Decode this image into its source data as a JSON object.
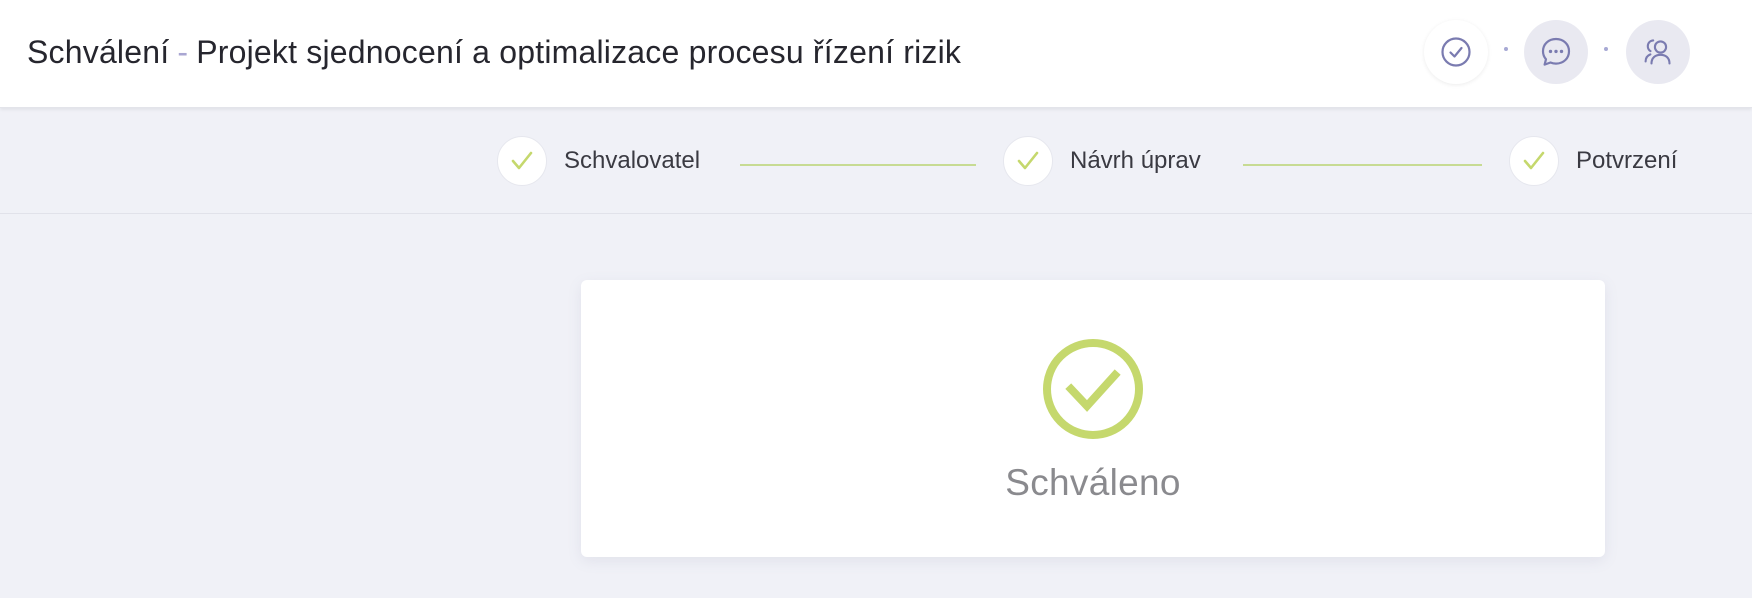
{
  "header": {
    "title_prefix": "Schválení",
    "title_separator": "-",
    "title_main": "Projekt sjednocení a optimalizace procesu řízení rizik",
    "buttons": [
      {
        "icon": "check-circle-icon"
      },
      {
        "icon": "comment-dots-icon"
      },
      {
        "icon": "users-icon"
      }
    ]
  },
  "stepper": {
    "steps": [
      {
        "label": "Schvalovatel",
        "completed": true
      },
      {
        "label": "Návrh úprav",
        "completed": true
      },
      {
        "label": "Potvrzení",
        "completed": true
      }
    ]
  },
  "result": {
    "status": "Schváleno",
    "icon": "check-circle-icon"
  },
  "colors": {
    "accent_green": "#c5d86d",
    "icon_purple": "#7a7bb0",
    "background": "#f0f1f7"
  }
}
